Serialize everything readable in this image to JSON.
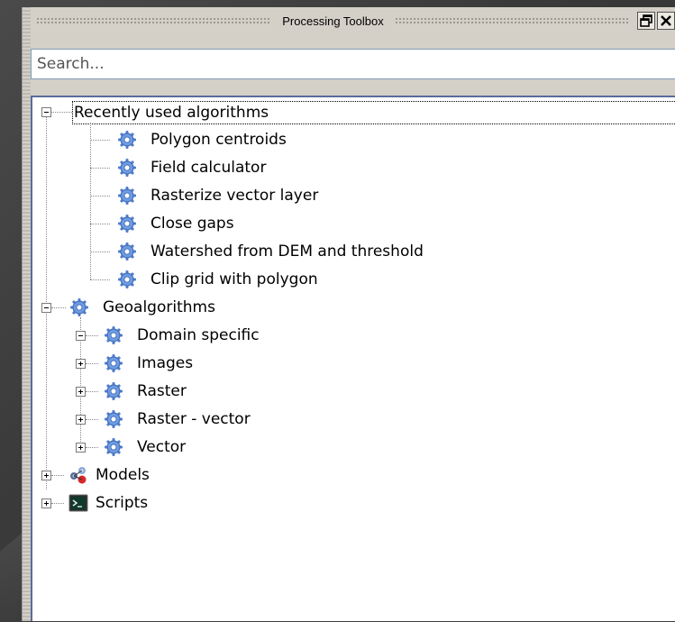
{
  "panel": {
    "title": "Processing Toolbox"
  },
  "search": {
    "placeholder": "Search..."
  },
  "tree": {
    "recent": {
      "label": "Recently used algorithms",
      "items": [
        "Polygon centroids",
        "Field calculator",
        "Rasterize vector layer",
        "Close gaps",
        "Watershed from DEM and threshold",
        "Clip grid with polygon"
      ]
    },
    "geoalgorithms": {
      "label": "Geoalgorithms",
      "items": [
        "Domain specific",
        "Images",
        "Raster",
        "Raster - vector",
        "Vector"
      ]
    },
    "models": {
      "label": "Models"
    },
    "scripts": {
      "label": "Scripts"
    }
  },
  "icons": {
    "algorithm": "gear-icon",
    "models": "model-icon",
    "scripts": "terminal-icon"
  },
  "colors": {
    "tree_border": "#5b6b9b",
    "gear_blue": "#4f7fd0"
  }
}
